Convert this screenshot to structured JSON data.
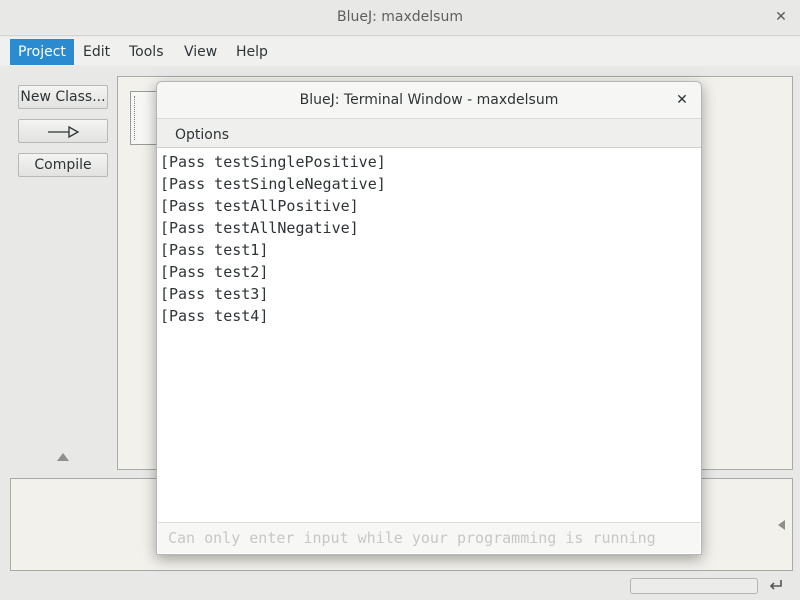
{
  "window": {
    "title": "BlueJ:  maxdelsum"
  },
  "menubar": {
    "items": [
      {
        "label": "Project",
        "active": true
      },
      {
        "label": "Edit",
        "active": false
      },
      {
        "label": "Tools",
        "active": false
      },
      {
        "label": "View",
        "active": false
      },
      {
        "label": "Help",
        "active": false
      }
    ]
  },
  "sidebar": {
    "new_class_label": "New Class...",
    "arrow_icon": "uses-arrow-icon",
    "compile_label": "Compile"
  },
  "terminal": {
    "title": "BlueJ: Terminal Window - maxdelsum",
    "menu_options_label": "Options",
    "output_lines": [
      "[Pass testSinglePositive]",
      "[Pass testSingleNegative]",
      "[Pass testAllPositive]",
      "[Pass testAllNegative]",
      "[Pass test1]",
      "[Pass test2]",
      "[Pass test3]",
      "[Pass test4]"
    ],
    "input_placeholder": "Can only enter input while your programming is running"
  },
  "colors": {
    "accent": "#2b8bd0",
    "background": "#e8e8e7",
    "diagram_background": "#f2f1ec"
  }
}
